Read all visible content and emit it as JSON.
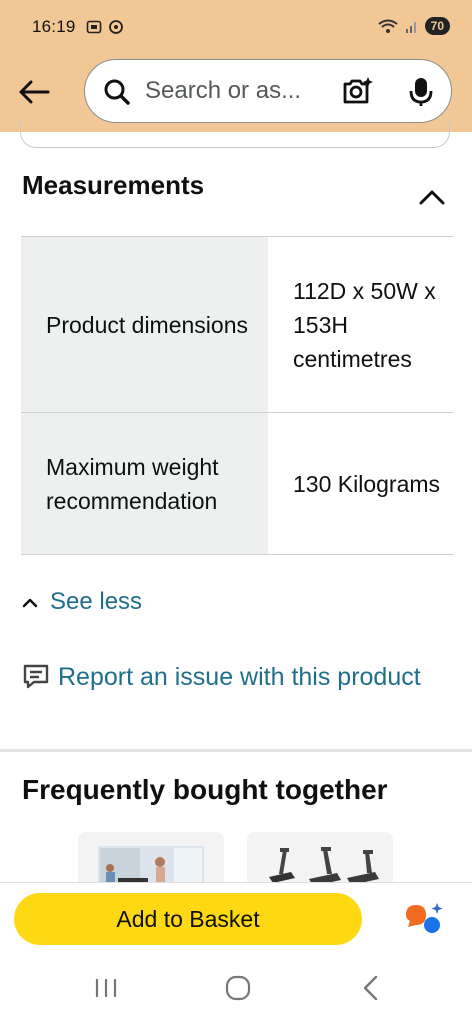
{
  "status_bar": {
    "time": "16:19",
    "battery": "70"
  },
  "search": {
    "placeholder": "Search or as..."
  },
  "measurements": {
    "title": "Measurements",
    "rows": [
      {
        "label": "Product dimensions",
        "value": "112D x 50W x 153H centimetres"
      },
      {
        "label": "Maximum weight recommendation",
        "value": "130 Kilograms"
      }
    ]
  },
  "see_less_label": "See less",
  "report_label": "Report an issue with this product",
  "frequently_bought": {
    "title": "Frequently bought together"
  },
  "basket": {
    "label": "Add to Basket"
  },
  "colors": {
    "header": "#f0c795",
    "link": "#1f6f8b",
    "button": "#ffd814"
  }
}
